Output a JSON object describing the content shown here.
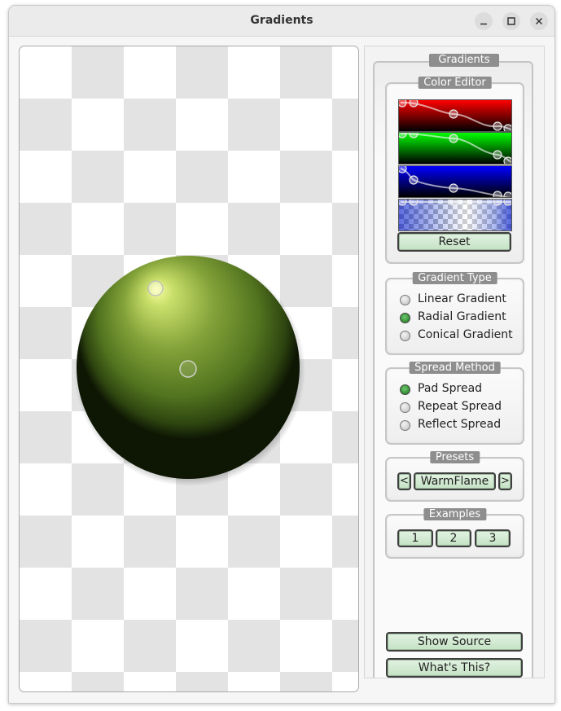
{
  "window": {
    "title": "Gradients"
  },
  "panel": {
    "title": "Gradients",
    "color_editor": {
      "title": "Color Editor",
      "channels": [
        "red",
        "green",
        "blue",
        "alpha"
      ],
      "reset_label": "Reset"
    },
    "gradient_type": {
      "title": "Gradient Type",
      "options": [
        {
          "label": "Linear Gradient",
          "checked": false
        },
        {
          "label": "Radial Gradient",
          "checked": true
        },
        {
          "label": "Conical Gradient",
          "checked": false
        }
      ]
    },
    "spread_method": {
      "title": "Spread Method",
      "options": [
        {
          "label": "Pad Spread",
          "checked": true
        },
        {
          "label": "Repeat Spread",
          "checked": false
        },
        {
          "label": "Reflect Spread",
          "checked": false
        }
      ]
    },
    "presets": {
      "title": "Presets",
      "prev_label": "<",
      "current": "WarmFlame",
      "next_label": ">"
    },
    "examples": {
      "title": "Examples",
      "buttons": [
        "1",
        "2",
        "3"
      ]
    },
    "show_source_label": "Show Source",
    "whats_this_label": "What's This?"
  },
  "colors": {
    "sphere_highlight": "#f8ffa0",
    "sphere_mid": "#5e7e22",
    "sphere_dark": "#1c2c08",
    "button_face": "#d3ecd3",
    "radio_checked": "#2e8b2e"
  }
}
